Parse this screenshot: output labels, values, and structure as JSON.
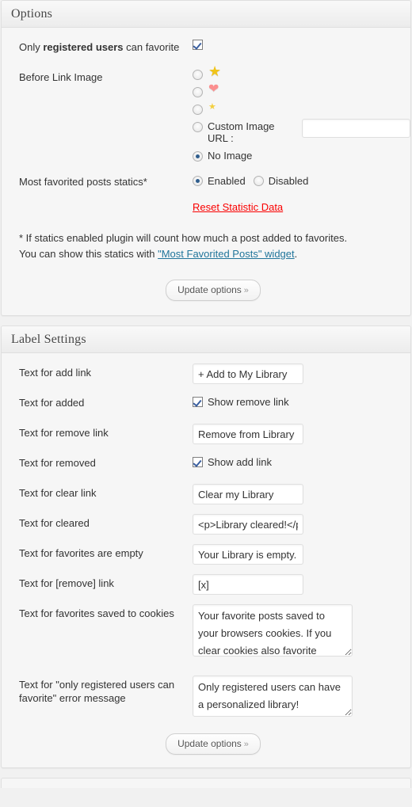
{
  "options_panel": {
    "title": "Options",
    "registered": {
      "label_pre": "Only ",
      "label_bold": "registered users",
      "label_post": " can favorite",
      "checked": true
    },
    "before_link_image": {
      "label": "Before Link Image",
      "choices": [
        {
          "name": "star-large",
          "icon": "star",
          "text": "",
          "selected": false
        },
        {
          "name": "heart",
          "icon": "heart",
          "text": "",
          "selected": false
        },
        {
          "name": "star-small",
          "icon": "star-small",
          "text": "",
          "selected": false
        },
        {
          "name": "custom-url",
          "icon": "",
          "text": "Custom Image URL :",
          "selected": false
        },
        {
          "name": "no-image",
          "icon": "",
          "text": "No Image",
          "selected": true
        }
      ],
      "custom_url_value": "",
      "custom_url_placeholder": ""
    },
    "statics": {
      "label": "Most favorited posts statics*",
      "enabled_label": "Enabled",
      "disabled_label": "Disabled",
      "selected": "Enabled",
      "reset_link": "Reset Statistic Data"
    },
    "note": {
      "line1": "* If statics enabled plugin will count how much a post added to favorites.",
      "line2_pre": "You can show this statics with ",
      "line2_link": "\"Most Favorited Posts\" widget",
      "line2_post": "."
    },
    "submit_label": "Update options",
    "submit_chevron": "»"
  },
  "label_panel": {
    "title": "Label Settings",
    "rows": [
      {
        "label": "Text for add link",
        "type": "text",
        "value": "+ Add to My Library"
      },
      {
        "label": "Text for added",
        "type": "checkbox",
        "value": "Show remove link",
        "checked": true
      },
      {
        "label": "Text for remove link",
        "type": "text",
        "value": "Remove from Library"
      },
      {
        "label": "Text for removed",
        "type": "checkbox",
        "value": "Show add link",
        "checked": true
      },
      {
        "label": "Text for clear link",
        "type": "text",
        "value": "Clear my Library"
      },
      {
        "label": "Text for cleared",
        "type": "text",
        "value": "<p>Library cleared!</p>"
      },
      {
        "label": "Text for favorites are empty",
        "type": "text",
        "value": "Your Library is empty. Y"
      },
      {
        "label": "Text for [remove] link",
        "type": "text",
        "value": "[x]"
      },
      {
        "label": "Text for favorites saved to cookies",
        "type": "textarea",
        "value": "Your favorite posts saved to your browsers cookies. If you clear cookies also favorite"
      },
      {
        "label": "Text for \"only registered users can favorite\" error message",
        "type": "textarea",
        "value": "Only registered users can have a personalized library!"
      }
    ],
    "submit_label": "Update options",
    "submit_chevron": "»"
  },
  "colors": {
    "link_red": "#fa0000",
    "link_blue": "#21759b",
    "panel_bg": "#f6f6f6",
    "panel_border": "#dfdfdf",
    "text": "#333333"
  }
}
